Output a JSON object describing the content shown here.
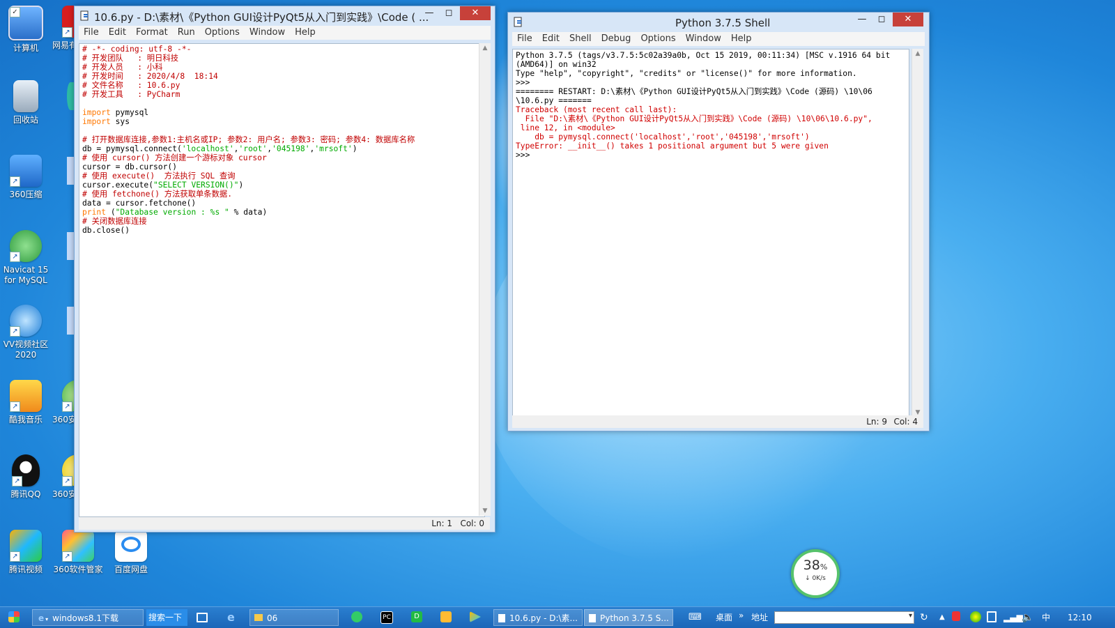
{
  "desktop": {
    "icons": [
      {
        "label": "计算机"
      },
      {
        "label": "网易有"
      },
      {
        "label": "回收站"
      },
      {
        "label": "360压缩"
      },
      {
        "label": "Navicat 15 for MySQL"
      },
      {
        "label": "VV视频社区 2020"
      },
      {
        "label": "酷我音乐"
      },
      {
        "label": "360安"
      },
      {
        "label": "腾讯QQ"
      },
      {
        "label": "360安"
      },
      {
        "label": "腾讯视频"
      },
      {
        "label": "360软件管家"
      },
      {
        "label": "百度网盘"
      }
    ]
  },
  "editor_window": {
    "title": "10.6.py - D:\\素材\\《Python GUI设计PyQt5从入门到实践》\\Code ( ...",
    "menu": [
      "File",
      "Edit",
      "Format",
      "Run",
      "Options",
      "Window",
      "Help"
    ],
    "lines": [
      [
        {
          "t": "# -*- coding: utf-8 -*-",
          "c": "com"
        }
      ],
      [
        {
          "t": "# 开发团队   : 明日科技",
          "c": "com"
        }
      ],
      [
        {
          "t": "# 开发人员   : 小科",
          "c": "com"
        }
      ],
      [
        {
          "t": "# 开发时间   : 2020/4/8  18:14",
          "c": "com"
        }
      ],
      [
        {
          "t": "# 文件名称   : 10.6.py",
          "c": "com"
        }
      ],
      [
        {
          "t": "# 开发工具   : PyCharm",
          "c": "com"
        }
      ],
      [
        {
          "t": "",
          "c": "def"
        }
      ],
      [
        {
          "t": "import",
          "c": "kw"
        },
        {
          "t": " pymysql",
          "c": "def"
        }
      ],
      [
        {
          "t": "import",
          "c": "kw"
        },
        {
          "t": " sys",
          "c": "def"
        }
      ],
      [
        {
          "t": "",
          "c": "def"
        }
      ],
      [
        {
          "t": "# 打开数据库连接,参数1:主机名或IP; 参数2: 用户名; 参数3: 密码; 参数4: 数据库名称",
          "c": "com"
        }
      ],
      [
        {
          "t": "db = pymysql.connect(",
          "c": "def"
        },
        {
          "t": "'localhost'",
          "c": "str"
        },
        {
          "t": ",",
          "c": "def"
        },
        {
          "t": "'root'",
          "c": "str"
        },
        {
          "t": ",",
          "c": "def"
        },
        {
          "t": "'045198'",
          "c": "str"
        },
        {
          "t": ",",
          "c": "def"
        },
        {
          "t": "'mrsoft'",
          "c": "str"
        },
        {
          "t": ")",
          "c": "def"
        }
      ],
      [
        {
          "t": "# 使用 cursor() 方法创建一个游标对象 cursor",
          "c": "com"
        }
      ],
      [
        {
          "t": "cursor = db.cursor()",
          "c": "def"
        }
      ],
      [
        {
          "t": "# 使用 execute()  方法执行 SQL 查询",
          "c": "com"
        }
      ],
      [
        {
          "t": "cursor.execute(",
          "c": "def"
        },
        {
          "t": "\"SELECT VERSION()\"",
          "c": "str"
        },
        {
          "t": ")",
          "c": "def"
        }
      ],
      [
        {
          "t": "# 使用 fetchone() 方法获取单条数据.",
          "c": "com"
        }
      ],
      [
        {
          "t": "data = cursor.fetchone()",
          "c": "def"
        }
      ],
      [
        {
          "t": "print",
          "c": "kw"
        },
        {
          "t": " (",
          "c": "def"
        },
        {
          "t": "\"Database version : %s \"",
          "c": "str"
        },
        {
          "t": " % data)",
          "c": "def"
        }
      ],
      [
        {
          "t": "# 关闭数据库连接",
          "c": "com"
        }
      ],
      [
        {
          "t": "db.close()",
          "c": "def"
        }
      ]
    ],
    "status_ln": "Ln: 1",
    "status_col": "Col: 0"
  },
  "shell_window": {
    "title": "Python 3.7.5 Shell",
    "menu": [
      "File",
      "Edit",
      "Shell",
      "Debug",
      "Options",
      "Window",
      "Help"
    ],
    "lines": [
      [
        {
          "t": "Python 3.7.5 (tags/v3.7.5:5c02a39a0b, Oct 15 2019, 00:11:34) [MSC v.1916 64 bit",
          "c": "out"
        }
      ],
      [
        {
          "t": "(AMD64)] on win32",
          "c": "out"
        }
      ],
      [
        {
          "t": "Type \"help\", \"copyright\", \"credits\" or \"license()\" for more information.",
          "c": "out"
        }
      ],
      [
        {
          "t": ">>> ",
          "c": "out"
        }
      ],
      [
        {
          "t": "======== RESTART: D:\\素材\\《Python GUI设计PyQt5从入门到实践》\\Code (源码) \\10\\06",
          "c": "out"
        }
      ],
      [
        {
          "t": "\\10.6.py =======",
          "c": "out"
        }
      ],
      [
        {
          "t": "Traceback (most recent call last):",
          "c": "err"
        }
      ],
      [
        {
          "t": "  File \"D:\\素材\\《Python GUI设计PyQt5从入门到实践》\\Code (源码) \\10\\06\\10.6.py\",",
          "c": "err"
        }
      ],
      [
        {
          "t": " line 12, in <module>",
          "c": "err"
        }
      ],
      [
        {
          "t": "    db = pymysql.connect('localhost','root','045198','mrsoft')",
          "c": "err"
        }
      ],
      [
        {
          "t": "TypeError: __init__() takes 1 positional argument but 5 were given",
          "c": "err"
        }
      ],
      [
        {
          "t": ">>> ",
          "c": "out"
        }
      ]
    ],
    "status_ln": "Ln: 9",
    "status_col": "Col: 4"
  },
  "network_widget": {
    "percent": "38",
    "percent_unit": "%",
    "speed": "↓ 0K/s"
  },
  "taskbar": {
    "ie_label": "windows8.1下载",
    "search_label": "搜索一下",
    "folder_label": "06",
    "editor_task": "10.6.py - D:\\素...",
    "shell_task": "Python 3.7.5 S...",
    "desktop_label": "桌面",
    "more_label": "»",
    "address_label": "地址",
    "ime_label": "中",
    "clock": "12:10"
  },
  "colors": {
    "comment": "#c00000",
    "keyword": "#ff7700",
    "string": "#00aa00",
    "error": "#d00000",
    "close_button": "#c7413a"
  }
}
